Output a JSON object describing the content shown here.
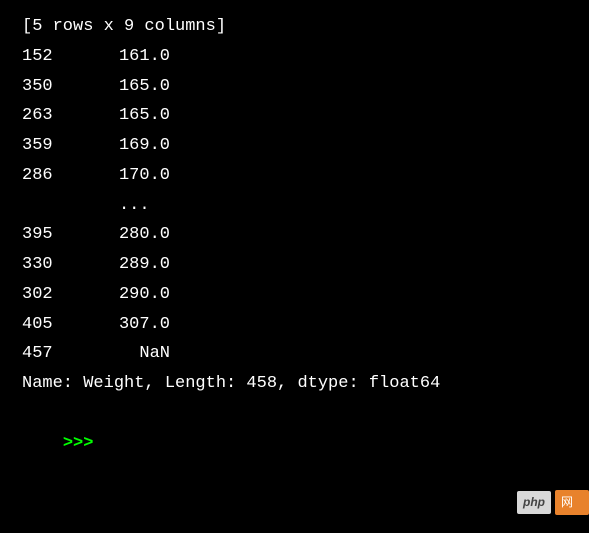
{
  "header": "[5 rows x 9 columns]",
  "rows_top": [
    {
      "idx": "152",
      "val": "161.0"
    },
    {
      "idx": "350",
      "val": "165.0"
    },
    {
      "idx": "263",
      "val": "165.0"
    },
    {
      "idx": "359",
      "val": "169.0"
    },
    {
      "idx": "286",
      "val": "170.0"
    }
  ],
  "ellipsis": "...  ",
  "rows_bottom": [
    {
      "idx": "395",
      "val": "280.0"
    },
    {
      "idx": "330",
      "val": "289.0"
    },
    {
      "idx": "302",
      "val": "290.0"
    },
    {
      "idx": "405",
      "val": "307.0"
    },
    {
      "idx": "457",
      "val": "NaN"
    }
  ],
  "meta": "Name: Weight, Length: 458, dtype: float64",
  "prompt": ">>>",
  "watermark": {
    "php": "php",
    "right": "网"
  }
}
